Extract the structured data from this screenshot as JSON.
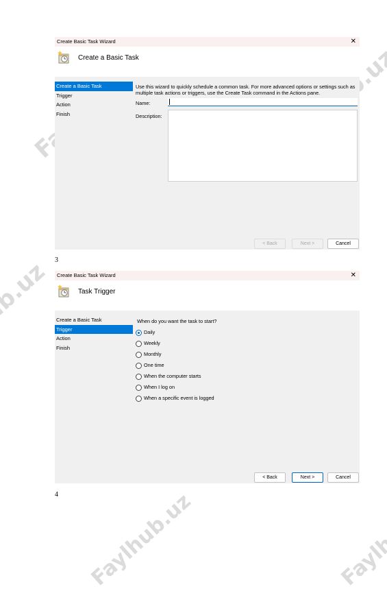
{
  "watermark": "Faylhub.uz",
  "dialogs": [
    {
      "window_title": "Create Basic Task Wizard",
      "close_glyph": "✕",
      "header_title": "Create a Basic Task",
      "header_icon": "task-scheduler-icon",
      "steps": [
        "Create a Basic Task",
        "Trigger",
        "Action",
        "Finish"
      ],
      "selected_step": 0,
      "description": "Use this wizard to quickly schedule a common task.  For more advanced options or settings such as multiple task actions or triggers, use the Create Task command in the Actions pane.",
      "name_label": "Name:",
      "name_value": "",
      "description_label": "Description:",
      "description_value": "",
      "buttons": {
        "back": "< Back",
        "next": "Next >",
        "cancel": "Cancel"
      }
    },
    {
      "window_title": "Create Basic Task Wizard",
      "close_glyph": "✕",
      "header_title": "Task Trigger",
      "header_icon": "task-scheduler-icon",
      "steps": [
        "Create a Basic Task",
        "Trigger",
        "Action",
        "Finish"
      ],
      "selected_step": 1,
      "question": "When do you want the task to start?",
      "options": [
        "Daily",
        "Weekly",
        "Monthly",
        "One time",
        "When the computer starts",
        "When I log on",
        "When a specific event is logged"
      ],
      "selected_option": "Daily",
      "buttons": {
        "back": "< Back",
        "next": "Next >",
        "cancel": "Cancel"
      }
    }
  ],
  "page_numbers": [
    "3",
    "4"
  ],
  "colors": {
    "selection": "#0078d7",
    "title_bar": "#fbf0f0",
    "dialog_body": "#f0f0f0",
    "accent": "#0067c0"
  }
}
